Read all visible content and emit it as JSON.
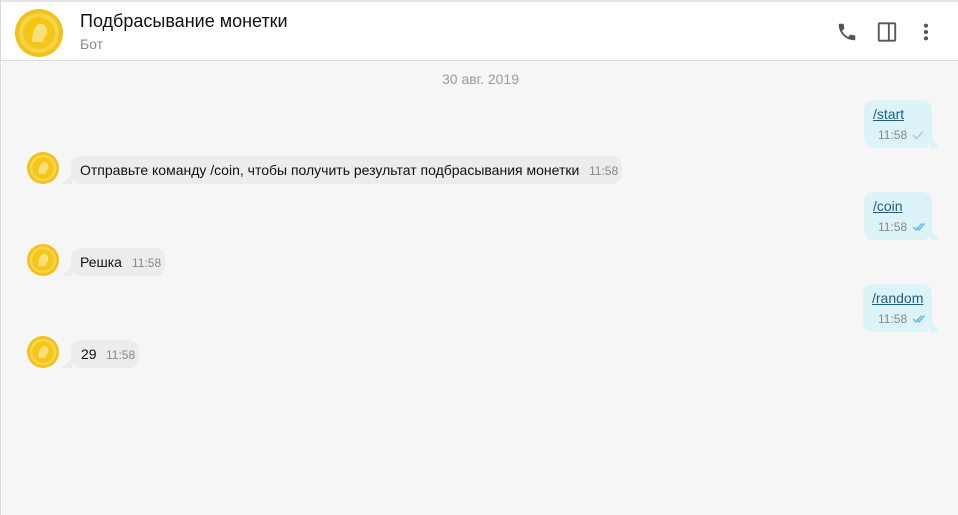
{
  "header": {
    "title": "Подбрасывание монетки",
    "subtitle": "Бот",
    "icons": [
      "phone-icon",
      "side-panel-icon",
      "more-vertical-icon"
    ]
  },
  "chat": {
    "date": "30 авг. 2019",
    "messages": [
      {
        "direction": "out",
        "text": "/start",
        "time": "11:58",
        "status": "sent"
      },
      {
        "direction": "in",
        "text": "Отправьте команду /coin, чтобы получить результат подбрасывания монетки",
        "time": "11:58"
      },
      {
        "direction": "out",
        "text": "/coin",
        "time": "11:58",
        "status": "read"
      },
      {
        "direction": "in",
        "text": "Решка",
        "time": "11:58"
      },
      {
        "direction": "out",
        "text": "/random",
        "time": "11:58",
        "status": "read"
      },
      {
        "direction": "in",
        "text": "29",
        "time": "11:58"
      }
    ]
  },
  "colors": {
    "incoming_bubble": "#ececec",
    "outgoing_bubble": "#dcf4f7",
    "link": "#1f5f86",
    "read_check": "#6cb6e6",
    "sent_check": "#b9c9cc",
    "avatar_coin": "#f5c518"
  }
}
